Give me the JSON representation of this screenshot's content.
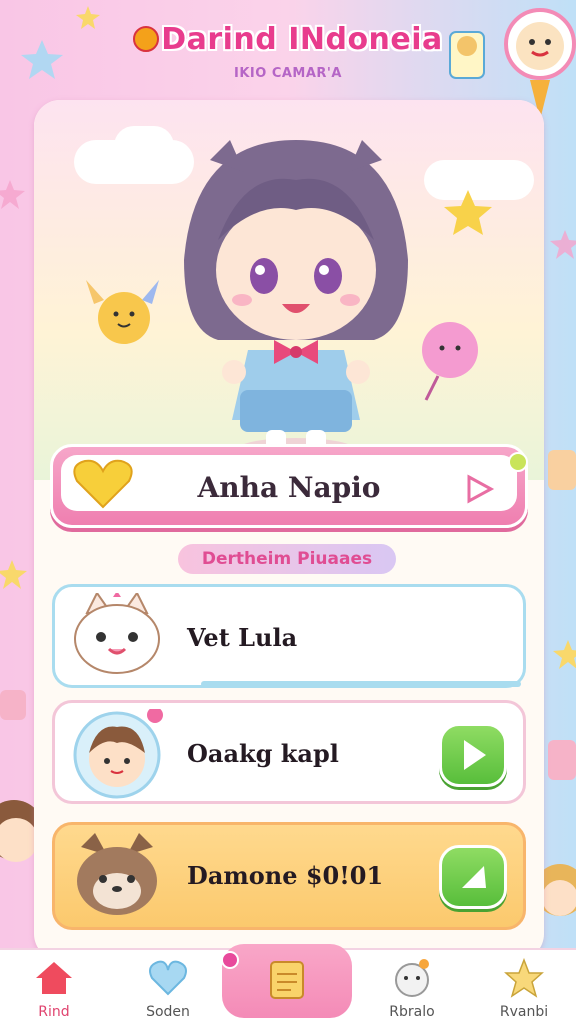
{
  "header": {
    "title": "Darind INdoneia",
    "subtitle": "IKIO CAMAR'A"
  },
  "profile": {
    "name": "Anha Napio"
  },
  "section": {
    "title": "Dertheim Piuaaes"
  },
  "items": [
    {
      "label": "Vet Lula"
    },
    {
      "label": "Oaakg kapl"
    },
    {
      "label": "Damone $0!01"
    }
  ],
  "nav": [
    {
      "label": "Rind",
      "icon": "home-icon"
    },
    {
      "label": "Soden",
      "icon": "heart-icon"
    },
    {
      "label": "",
      "icon": "note-icon"
    },
    {
      "label": "Rbralo",
      "icon": "face-icon"
    },
    {
      "label": "Rvanbi",
      "icon": "star-icon"
    }
  ],
  "colors": {
    "accent": "#e83c8d",
    "banner": "#ef7fb0",
    "green_button": "#58be3b",
    "gold_item": "#fbc96d"
  }
}
